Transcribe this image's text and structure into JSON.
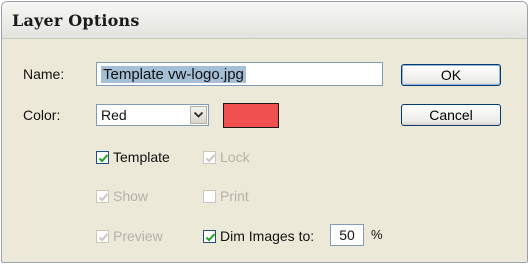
{
  "dialog": {
    "title": "Layer Options"
  },
  "name_field": {
    "label": "Name:",
    "value": "Template vw-logo.jpg"
  },
  "color_field": {
    "label": "Color:",
    "selected": "Red",
    "swatch_color": "#f05050"
  },
  "buttons": {
    "ok": "OK",
    "cancel": "Cancel"
  },
  "checkboxes": {
    "template": {
      "label": "Template",
      "checked": true,
      "enabled": true
    },
    "lock": {
      "label": "Lock",
      "checked": true,
      "enabled": false
    },
    "show": {
      "label": "Show",
      "checked": true,
      "enabled": false
    },
    "print": {
      "label": "Print",
      "checked": false,
      "enabled": false
    },
    "preview": {
      "label": "Preview",
      "checked": true,
      "enabled": false
    },
    "dim_images": {
      "label": "Dim Images to:",
      "checked": true,
      "enabled": true
    }
  },
  "dim_value": {
    "value": "50",
    "unit": "%"
  },
  "icons": {
    "dropdown": "chevron-down-icon",
    "check": "check-icon"
  }
}
